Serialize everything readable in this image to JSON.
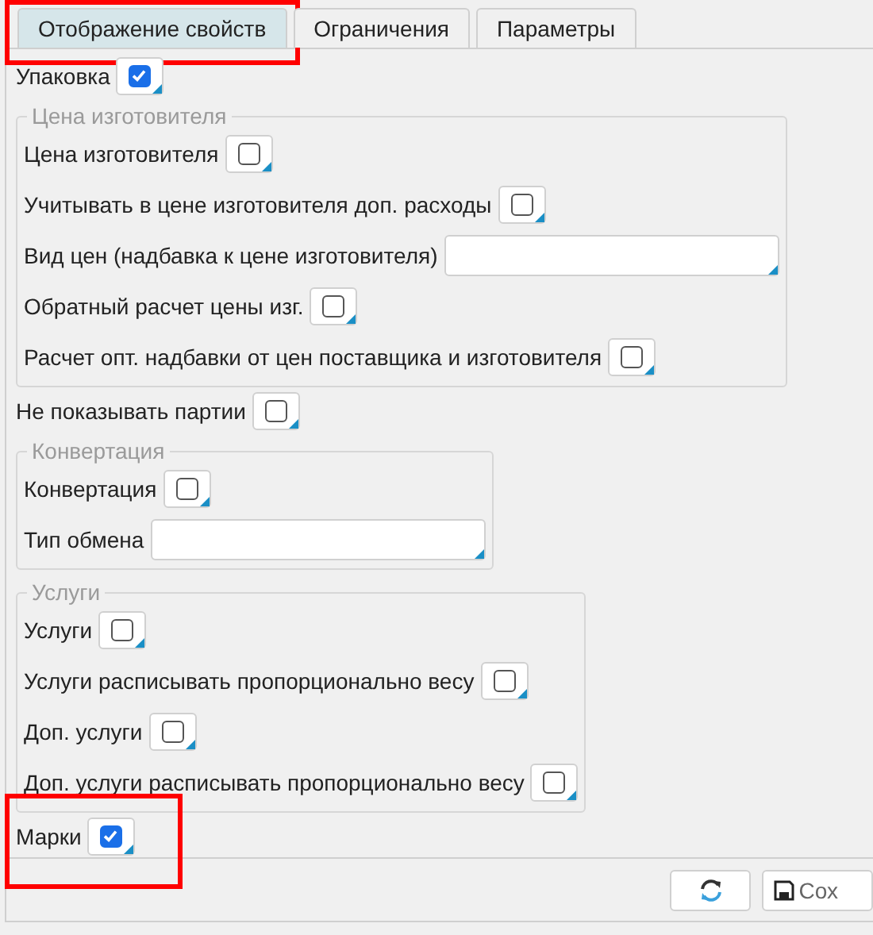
{
  "tabs": [
    {
      "label": "Отображение свойств",
      "selected": true,
      "highlighted": true
    },
    {
      "label": "Ограничения",
      "selected": false,
      "highlighted": false
    },
    {
      "label": "Параметры",
      "selected": false,
      "highlighted": false
    }
  ],
  "items": [
    {
      "kind": "checkbox",
      "label": "Упаковка",
      "checked": true,
      "highlighted": false
    },
    {
      "kind": "group",
      "title": "Цена изготовителя",
      "children": [
        {
          "kind": "checkbox",
          "label": "Цена изготовителя",
          "checked": false,
          "highlighted": false
        },
        {
          "kind": "checkbox",
          "label": "Учитывать в цене изготовителя доп. расходы",
          "checked": false,
          "highlighted": false
        },
        {
          "kind": "field",
          "label": "Вид цен (надбавка к цене изготовителя)"
        },
        {
          "kind": "checkbox",
          "label": "Обратный расчет цены изг.",
          "checked": false,
          "highlighted": false
        },
        {
          "kind": "checkbox",
          "label": "Расчет опт. надбавки от цен поставщика и изготовителя",
          "checked": false,
          "highlighted": false
        }
      ]
    },
    {
      "kind": "checkbox",
      "label": "Не показывать партии",
      "checked": false,
      "highlighted": false
    },
    {
      "kind": "group",
      "title": "Конвертация",
      "children": [
        {
          "kind": "checkbox",
          "label": "Конвертация",
          "checked": false,
          "highlighted": false
        },
        {
          "kind": "field",
          "label": "Тип обмена"
        }
      ]
    },
    {
      "kind": "group",
      "title": "Услуги",
      "children": [
        {
          "kind": "checkbox",
          "label": "Услуги",
          "checked": false,
          "highlighted": false
        },
        {
          "kind": "checkbox",
          "label": "Услуги расписывать пропорционально весу",
          "checked": false,
          "highlighted": false
        },
        {
          "kind": "checkbox",
          "label": "Доп. услуги",
          "checked": false,
          "highlighted": false
        },
        {
          "kind": "checkbox",
          "label": "Доп. услуги расписывать пропорционально весу",
          "checked": false,
          "highlighted": false
        }
      ]
    },
    {
      "kind": "checkbox",
      "label": "Марки",
      "checked": true,
      "highlighted": true
    }
  ],
  "buttons": [
    {
      "kind": "refresh"
    },
    {
      "kind": "save",
      "label": "Сох"
    }
  ]
}
